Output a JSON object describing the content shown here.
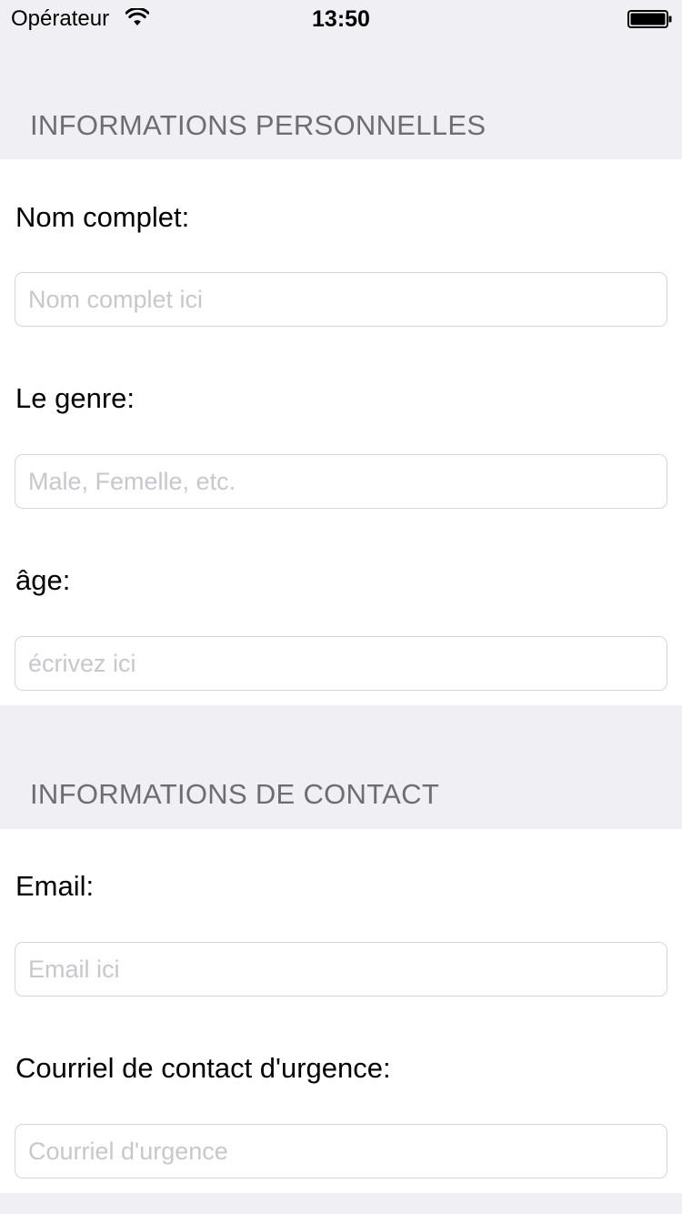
{
  "status_bar": {
    "carrier": "Opérateur",
    "time": "13:50",
    "wifi_icon": "wifi-icon",
    "battery_icon": "battery-icon"
  },
  "sections": {
    "personal": {
      "title": "INFORMATIONS PERSONNELLES",
      "fields": {
        "full_name": {
          "label": "Nom complet:",
          "placeholder": "Nom complet ici",
          "value": ""
        },
        "gender": {
          "label": "Le genre:",
          "placeholder": "Male, Femelle, etc.",
          "value": ""
        },
        "age": {
          "label": "âge:",
          "placeholder": "écrivez ici",
          "value": ""
        }
      }
    },
    "contact": {
      "title": "INFORMATIONS DE CONTACT",
      "fields": {
        "email": {
          "label": "Email:",
          "placeholder": "Email ici",
          "value": ""
        },
        "emergency_email": {
          "label": "Courriel de contact d'urgence:",
          "placeholder": "Courriel d'urgence",
          "value": ""
        }
      }
    }
  },
  "colors": {
    "background": "#efeff4",
    "section_header_text": "#6d6d72",
    "card": "#ffffff",
    "placeholder": "#c7c7cd",
    "input_border": "#d6d6d9"
  }
}
